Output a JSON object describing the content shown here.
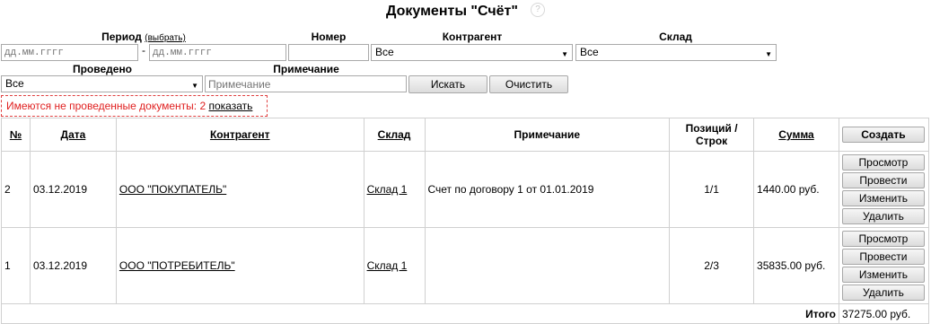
{
  "page": {
    "title": "Документы \"Счёт\"",
    "help": "?"
  },
  "filters": {
    "period_label": "Период",
    "period_select_link": "(выбрать)",
    "date_from_placeholder": "дд.мм.гггг",
    "date_sep": "-",
    "date_to_placeholder": "дд.мм.гггг",
    "number_label": "Номер",
    "number_value": "",
    "counterparty_label": "Контрагент",
    "counterparty_value": "Все",
    "warehouse_label": "Склад",
    "warehouse_value": "Все",
    "posted_label": "Проведено",
    "posted_value": "Все",
    "note_label": "Примечание",
    "note_placeholder": "Примечание",
    "search_button": "Искать",
    "clear_button": "Очистить"
  },
  "warning": {
    "text": "Имеются не проведенные документы: 2",
    "link": "показать"
  },
  "table": {
    "headers": {
      "num": "№",
      "date": "Дата",
      "counterparty": "Контрагент",
      "warehouse": "Склад",
      "note": "Примечание",
      "positions_line1": "Позиций /",
      "positions_line2": "Строк",
      "sum": "Сумма",
      "create_button": "Создать"
    },
    "rows": [
      {
        "num": "2",
        "date": "03.12.2019",
        "counterparty": "ООО \"ПОКУПАТЕЛЬ\"",
        "warehouse": "Склад 1",
        "note": "Счет по договору 1 от 01.01.2019",
        "positions": "1/1",
        "sum": "1440.00 руб."
      },
      {
        "num": "1",
        "date": "03.12.2019",
        "counterparty": "ООО \"ПОТРЕБИТЕЛЬ\"",
        "warehouse": "Склад 1",
        "note": "",
        "positions": "2/3",
        "sum": "35835.00 руб."
      }
    ],
    "row_actions": {
      "view": "Просмотр",
      "post": "Провести",
      "edit": "Изменить",
      "delete": "Удалить"
    },
    "total_label": "Итого",
    "total_value": "37275.00 руб."
  }
}
